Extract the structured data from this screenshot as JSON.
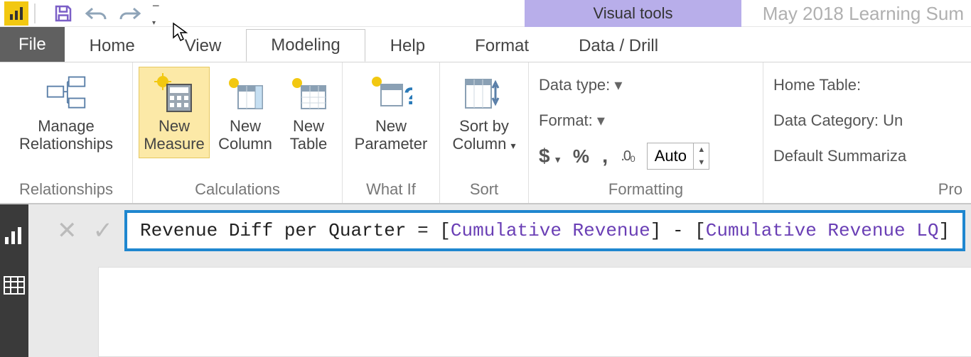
{
  "titlebar": {
    "context_tab": "Visual tools",
    "doc_title": "May 2018 Learning Sum"
  },
  "tabs": {
    "file": "File",
    "home": "Home",
    "view": "View",
    "modeling": "Modeling",
    "help": "Help",
    "format": "Format",
    "data_drill": "Data / Drill"
  },
  "ribbon": {
    "relationships": {
      "manage_l1": "Manage",
      "manage_l2": "Relationships",
      "group": "Relationships"
    },
    "calculations": {
      "new_measure_l1": "New",
      "new_measure_l2": "Measure",
      "new_column_l1": "New",
      "new_column_l2": "Column",
      "new_table_l1": "New",
      "new_table_l2": "Table",
      "group": "Calculations"
    },
    "whatif": {
      "new_param_l1": "New",
      "new_param_l2": "Parameter",
      "group": "What If"
    },
    "sort": {
      "sortby_l1": "Sort by",
      "sortby_l2": "Column",
      "group": "Sort"
    },
    "formatting": {
      "data_type": "Data type:",
      "format": "Format:",
      "currency": "$",
      "percent": "%",
      "thousands": ",",
      "decimals_auto": "Auto",
      "decimals_sym": ".0₀",
      "group": "Formatting"
    },
    "properties": {
      "home_table": "Home Table:",
      "data_category": "Data Category: Un",
      "default_summarization": "Default Summariza",
      "group": "Pro"
    }
  },
  "formula": {
    "prefix": "Revenue Diff per Quarter = ",
    "bracket_open_1": "[",
    "measure1": "Cumulative Revenue",
    "bracket_close_1": "]",
    "minus": " - ",
    "bracket_open_2": "[",
    "measure2": "Cumulative Revenue LQ",
    "bracket_close_2": "]"
  }
}
